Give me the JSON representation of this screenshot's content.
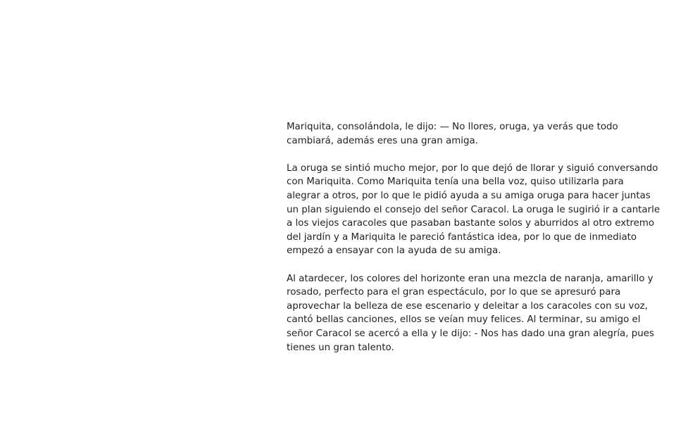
{
  "story": {
    "paragraphs": [
      {
        "lines": [
          "Mariquita, consolándola, le dijo: — No llores, oruga, ya verás que todo",
          "cambiará, además eres una gran amiga."
        ]
      },
      {
        "lines": [
          "La oruga se sintió mucho mejor, por lo que dejó de llorar y siguió conversando",
          "con Mariquita. Como Mariquita tenía una bella voz, quiso utilizarla para",
          "alegrar a otros, por lo que le pidió ayuda a su amiga oruga para hacer juntas",
          "un plan siguiendo el consejo del señor Caracol. La oruga le sugirió ir a cantarle",
          "a los viejos caracoles que pasaban bastante solos y aburridos al otro extremo",
          "del jardín y a Mariquita le pareció fantástica idea, por lo que de inmediato",
          "empezó a ensayar con la ayuda de su amiga."
        ]
      },
      {
        "lines": [
          "Al atardecer, los colores del horizonte eran una mezcla de naranja, amarillo y",
          "rosado, perfecto para el gran espectáculo, por lo que se apresuró para",
          "aprovechar la belleza de ese escenario y deleitar a los caracoles con su voz,",
          "cantó bellas canciones, ellos se veían muy felices. Al terminar, su amigo el",
          "señor Caracol se acercó a ella y le dijo: - Nos has dado una gran alegría, pues",
          "tienes un gran talento."
        ]
      }
    ]
  }
}
